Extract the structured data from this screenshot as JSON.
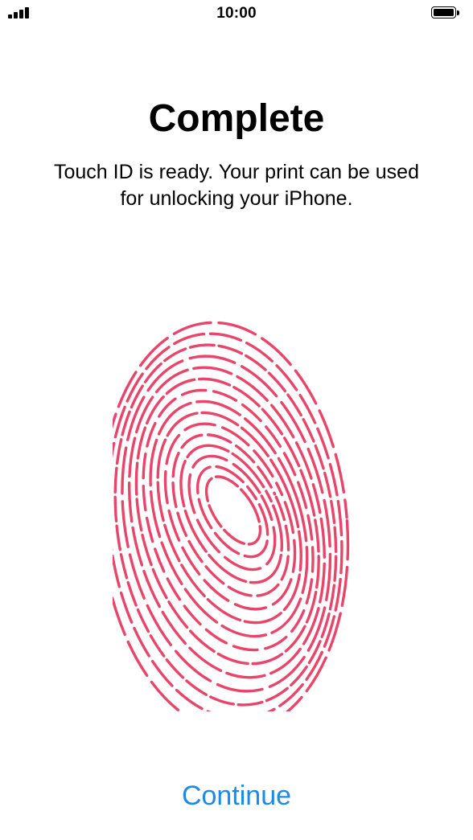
{
  "status_bar": {
    "time": "10:00",
    "signal_icon": "cellular-signal-icon",
    "battery_icon": "battery-full-icon"
  },
  "content": {
    "title": "Complete",
    "message_line1": "Touch ID is ready. Your print can be used",
    "message_line2": "for unlocking your iPhone.",
    "fingerprint_icon": "fingerprint-icon",
    "fingerprint_color": "#e8456a"
  },
  "actions": {
    "continue_label": "Continue",
    "accent_color": "#1a8bea"
  }
}
